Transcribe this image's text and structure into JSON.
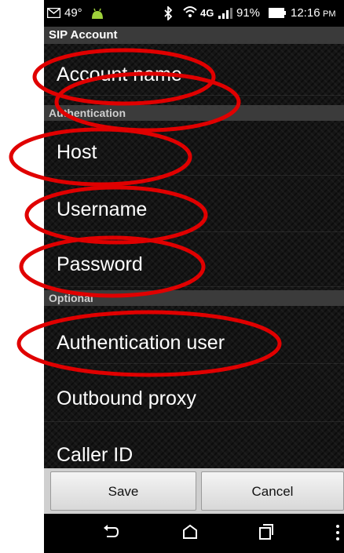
{
  "status_bar": {
    "temperature": "49°",
    "battery": "91%",
    "time": "12:16",
    "time_suffix": "PM",
    "network": "4G"
  },
  "screen_title": "SIP Account",
  "rows": {
    "account_name": "Account name",
    "host": "Host",
    "username": "Username",
    "password": "Password",
    "authentication_user": "Authentication user",
    "outbound_proxy": "Outbound proxy",
    "caller_id": "Caller ID"
  },
  "sections": {
    "authentication": "Authentication",
    "optional": "Optional"
  },
  "buttons": {
    "save": "Save",
    "cancel": "Cancel"
  },
  "colors": {
    "annotation": "#e00000",
    "section_header": "#3b3b3b",
    "status_bar": "#000000"
  },
  "icons": [
    "email-icon",
    "android-icon",
    "bluetooth-icon",
    "wifi-icon",
    "signal-icon",
    "battery-icon",
    "back-icon",
    "home-icon",
    "recents-icon",
    "menu-icon"
  ]
}
